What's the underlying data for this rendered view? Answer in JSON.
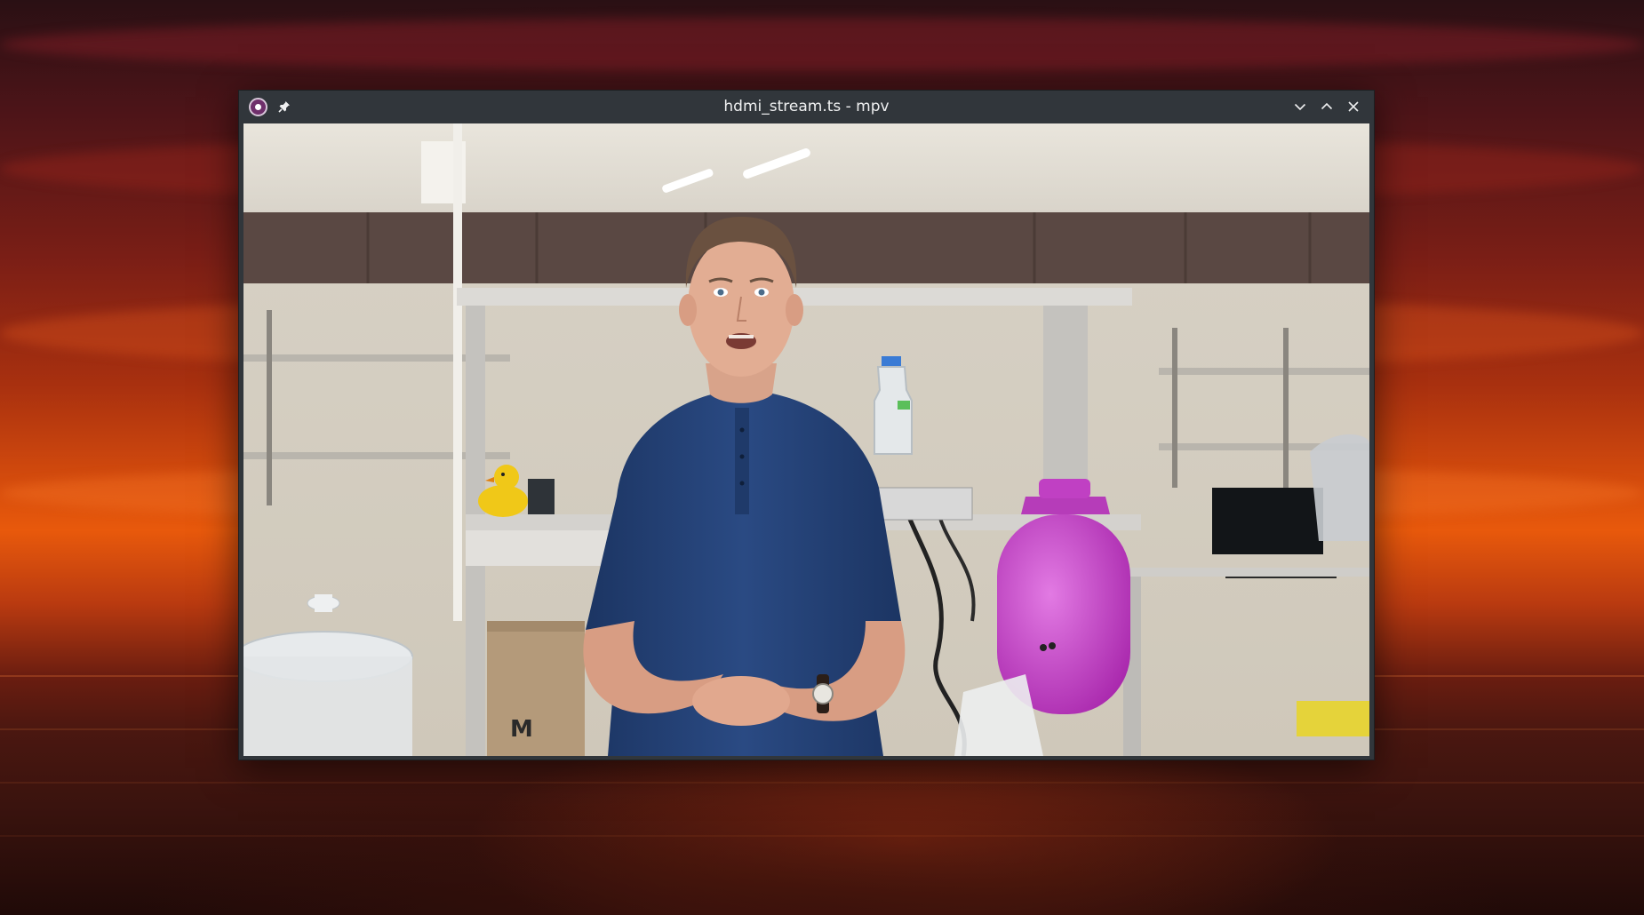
{
  "window": {
    "title": "hdmi_stream.ts - mpv",
    "app_icon": "mpv-logo-icon",
    "buttons": {
      "pin": "pin-icon",
      "minimize": "chevron-down-icon",
      "maximize": "chevron-up-icon",
      "close": "close-icon"
    }
  },
  "video": {
    "box_marking": "M"
  },
  "colors": {
    "titlebar_bg": "#31363b",
    "title_text": "#eff0f1",
    "gas_cylinder": "#c63ac9",
    "shirt": "#233f73"
  }
}
